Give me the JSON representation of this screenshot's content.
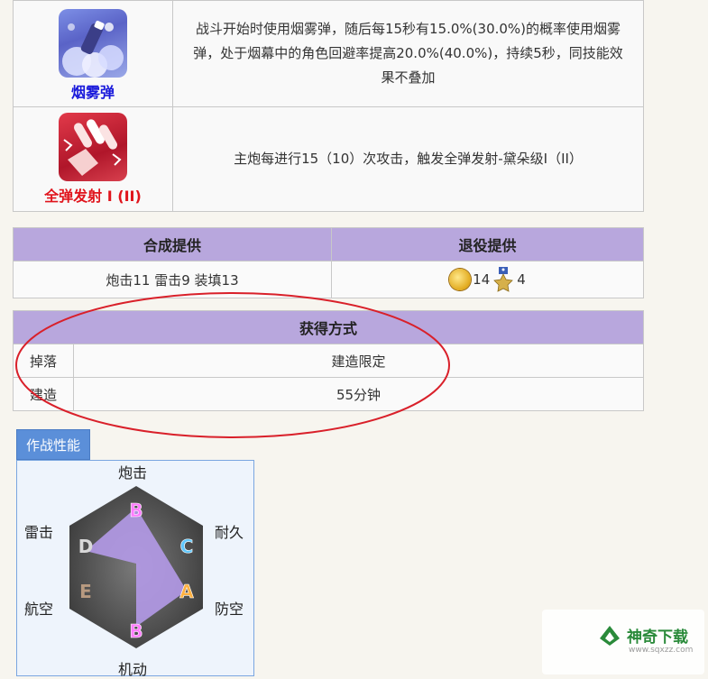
{
  "skills": [
    {
      "name": "烟雾弹",
      "icon": "smoke-bomb-icon",
      "name_color": "#1a1adb",
      "desc": "战斗开始时使用烟雾弹，随后每15秒有15.0%(30.0%)的概率使用烟雾弹，处于烟幕中的角色回避率提高20.0%(40.0%)，持续5秒，同技能效果不叠加"
    },
    {
      "name": "全弹发射 I (II)",
      "icon": "full-barrage-icon",
      "name_color": "#e0141c",
      "desc": "主炮每进行15（10）次攻击，触发全弹发射-黛朵级I（II）"
    }
  ],
  "provide": {
    "headers": [
      "合成提供",
      "退役提供"
    ],
    "synthesis": "炮击11 雷击9 装填13",
    "retire_coin": "14",
    "retire_medal": "4"
  },
  "acquire": {
    "title": "获得方式",
    "rows": [
      {
        "label": "掉落",
        "value": "建造限定"
      },
      {
        "label": "建造",
        "value": "55分钟"
      }
    ]
  },
  "stats": {
    "tab": "作战性能",
    "axes": {
      "top": "炮击",
      "top_right": "耐久",
      "bottom_right": "防空",
      "bottom": "机动",
      "bottom_left": "航空",
      "top_left": "雷击"
    },
    "grades": {
      "firepower": "B",
      "durability": "C",
      "antiair": "A",
      "evasion": "B",
      "aviation": "E",
      "torpedo": "D"
    },
    "grade_colors": {
      "A": "#ffb040",
      "B": "#ff7bff",
      "C": "#5fc8ff",
      "D": "#d8d8d8",
      "E": "#b89a80"
    }
  },
  "watermark": {
    "brand": "神奇下载",
    "url": "www.sqxzz.com"
  }
}
